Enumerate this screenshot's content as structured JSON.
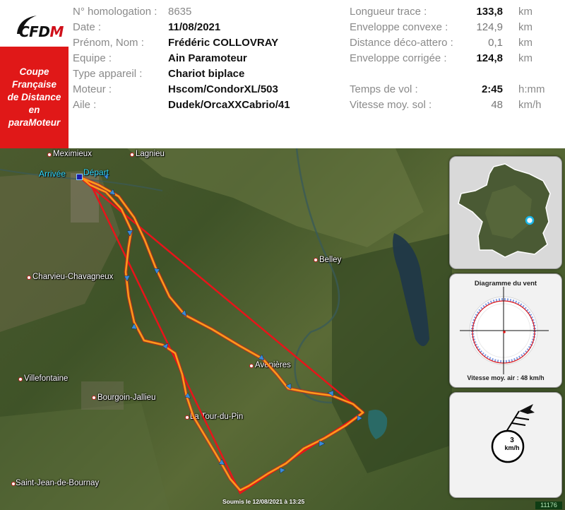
{
  "header": {
    "logo": {
      "text_main": "CFD",
      "text_accent": "M",
      "icon": "paraglider-wing-icon"
    },
    "banner_lines": [
      "Coupe",
      "Française",
      "de Distance",
      "en",
      "paraMoteur"
    ],
    "fields_left": [
      {
        "label": "N° homologation :",
        "value": "8635",
        "style": "plain"
      },
      {
        "label": "Date :",
        "value": "11/08/2021",
        "style": "bold"
      },
      {
        "label": "Prénom, Nom :",
        "value": "Frédéric COLLOVRAY",
        "style": "bold"
      },
      {
        "label": "Equipe :",
        "value": "Ain Paramoteur",
        "style": "bold"
      },
      {
        "label": "Type appareil :",
        "value": "Chariot biplace",
        "style": "bold"
      },
      {
        "label": "Moteur :",
        "value": "Hscom/CondorXL/503",
        "style": "bold"
      },
      {
        "label": "Aile :",
        "value": "Dudek/OrcaXXCabrio/41",
        "style": "bold"
      }
    ],
    "fields_right": [
      {
        "label": "Longueur trace :",
        "value": "133,8",
        "unit": "km",
        "style": "bold"
      },
      {
        "label": "Enveloppe convexe :",
        "value": "124,9",
        "unit": "km",
        "style": "plain"
      },
      {
        "label": "Distance déco-attero :",
        "value": "0,1",
        "unit": "km",
        "style": "plain"
      },
      {
        "label": "Enveloppe corrigée :",
        "value": "124,8",
        "unit": "km",
        "style": "bold"
      },
      {
        "label": "Temps de vol :",
        "value": "2:45",
        "unit": "h:mm",
        "style": "bold"
      },
      {
        "label": "Vitesse moy. sol :",
        "value": "48",
        "unit": "km/h",
        "style": "plain"
      }
    ]
  },
  "map": {
    "towns": [
      {
        "name": "Meximieux"
      },
      {
        "name": "Lagnieu"
      },
      {
        "name": "Belley"
      },
      {
        "name": "Charvieu-Chavagneux"
      },
      {
        "name": "Avenières"
      },
      {
        "name": "Villefontaine"
      },
      {
        "name": "Bourgoin-Jallieu"
      },
      {
        "name": "La Tour-du-Pin"
      },
      {
        "name": "Saint-Jean-de-Bournay"
      }
    ],
    "arrival_label": "Arrivée",
    "start_label": "Départ",
    "submitted_text": "Soumis le 12/08/2021 à 13:25",
    "flight_id": "11176",
    "colors": {
      "track": "#ff9a1a",
      "envelope": "#e8141a",
      "arrows": "#3a8ad8"
    }
  },
  "panels": {
    "france_map": {
      "icon": "france-map-icon",
      "marker": "takeoff-location-marker"
    },
    "wind_diagram": {
      "title": "Diagramme du vent",
      "caption": "Vitesse moy. air : 48 km/h"
    },
    "wind_speed": {
      "value": "3",
      "unit": "km/h",
      "icon": "wind-flag-icon"
    }
  }
}
